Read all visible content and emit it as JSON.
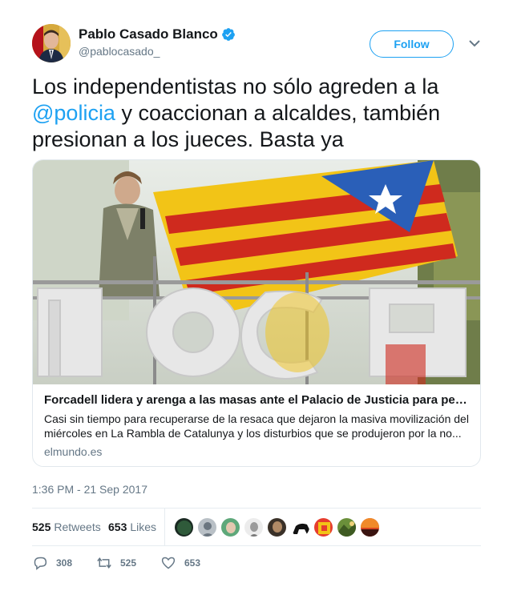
{
  "author": {
    "display_name": "Pablo Casado Blanco",
    "handle": "@pablocasado_",
    "avatar_icon": "profile-photo",
    "verified_icon": "verified-badge-icon"
  },
  "follow_label": "Follow",
  "tweet": {
    "text_before": "Los independentistas no sólo agreden a la ",
    "mention": "@policia",
    "text_after": " y coaccionan a alcaldes, también presionan a los jueces. Basta ya"
  },
  "card": {
    "title": "Forcadell lidera y arenga a las masas ante el Palacio de Justicia para pedir la ...",
    "description": "Casi sin tiempo para recuperarse de la resaca que dejaron la masiva movilización del miércoles en La Rambla de Catalunya y los disturbios que se produjeron por la no...",
    "domain": "elmundo.es",
    "image_text": "MOCR"
  },
  "timestamp": "1:36 PM - 21 Sep 2017",
  "stats": {
    "retweets_count": "525",
    "retweets_label": "Retweets",
    "likes_count": "653",
    "likes_label": "Likes"
  },
  "actions": {
    "reply_count": "308",
    "retweet_count": "525",
    "like_count": "653"
  },
  "colors": {
    "accent": "#1da1f2",
    "secondary_text": "#657786",
    "border": "#e1e8ed"
  }
}
